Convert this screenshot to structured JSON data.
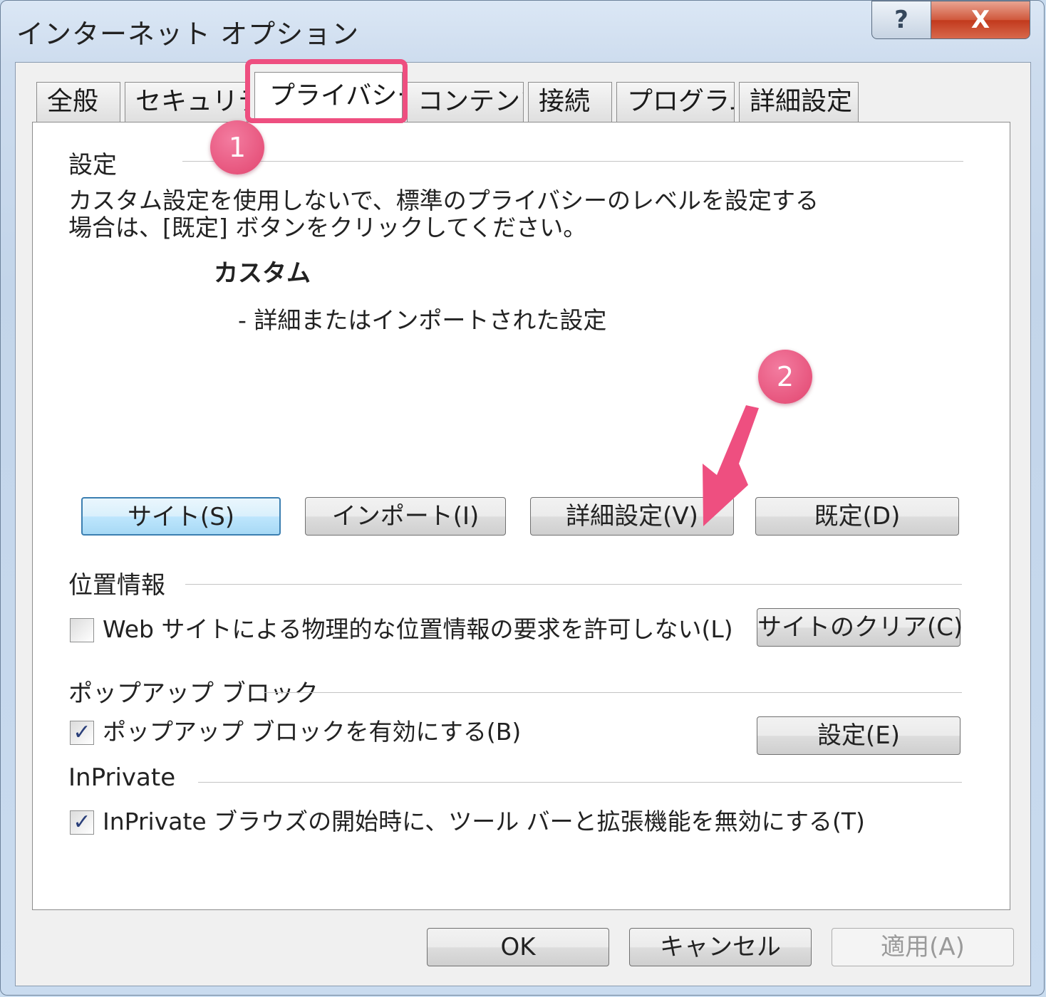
{
  "window": {
    "title": "インターネット オプション",
    "help_label": "?",
    "close_label": "X"
  },
  "tabs": [
    {
      "label": "全般"
    },
    {
      "label": "セキュリティ"
    },
    {
      "label": "プライバシー"
    },
    {
      "label": "コンテンツ"
    },
    {
      "label": "接続"
    },
    {
      "label": "プログラム"
    },
    {
      "label": "詳細設定"
    }
  ],
  "settings": {
    "group_label": "設定",
    "desc_line1": "カスタム設定を使用しないで、標準のプライバシーのレベルを設定する",
    "desc_line2": "場合は、[既定] ボタンをクリックしてください。",
    "level_name": "カスタム",
    "level_desc": "- 詳細またはインポートされた設定",
    "buttons": {
      "sites": "サイト(S)",
      "import": "インポート(I)",
      "advanced": "詳細設定(V)",
      "default": "既定(D)"
    }
  },
  "location": {
    "group_label": "位置情報",
    "checkbox_label": "Web サイトによる物理的な位置情報の要求を許可しない(L)",
    "checked": false,
    "clear_button": "サイトのクリア(C)"
  },
  "popup": {
    "group_label": "ポップアップ ブロック",
    "checkbox_label": "ポップアップ ブロックを有効にする(B)",
    "checked": true,
    "settings_button": "設定(E)"
  },
  "inprivate": {
    "group_label": "InPrivate",
    "checkbox_label": "InPrivate ブラウズの開始時に、ツール バーと拡張機能を無効にする(T)",
    "checked": true
  },
  "footer": {
    "ok": "OK",
    "cancel": "キャンセル",
    "apply": "適用(A)"
  },
  "annotations": {
    "marker1": "1",
    "marker2": "2",
    "color": "#ee4f80"
  },
  "check_glyph": "✓"
}
